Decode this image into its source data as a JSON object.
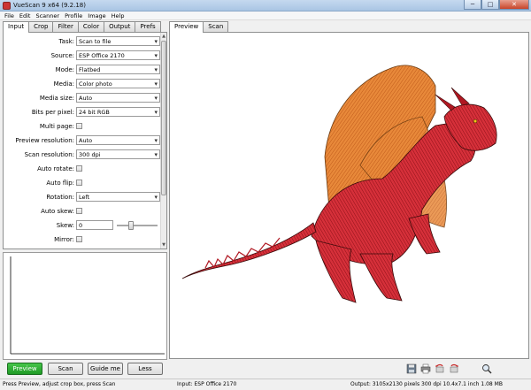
{
  "window": {
    "title": "VueScan 9 x64 (9.2.18)",
    "minimize": "─",
    "maximize": "□",
    "close": "✕"
  },
  "menu": [
    "File",
    "Edit",
    "Scanner",
    "Profile",
    "Image",
    "Help"
  ],
  "left_tabs": [
    "Input",
    "Crop",
    "Filter",
    "Color",
    "Output",
    "Prefs"
  ],
  "right_tabs": [
    "Preview",
    "Scan"
  ],
  "input": {
    "task_label": "Task:",
    "task_value": "Scan to file",
    "source_label": "Source:",
    "source_value": "ESP Office 2170",
    "mode_label": "Mode:",
    "mode_value": "Flatbed",
    "media_label": "Media:",
    "media_value": "Color photo",
    "media_size_label": "Media size:",
    "media_size_value": "Auto",
    "bits_label": "Bits per pixel:",
    "bits_value": "24 bit RGB",
    "multi_page_label": "Multi page:",
    "preview_res_label": "Preview resolution:",
    "preview_res_value": "Auto",
    "scan_res_label": "Scan resolution:",
    "scan_res_value": "300 dpi",
    "auto_rotate_label": "Auto rotate:",
    "auto_flip_label": "Auto flip:",
    "rotation_label": "Rotation:",
    "rotation_value": "Left",
    "auto_skew_label": "Auto skew:",
    "skew_label": "Skew:",
    "skew_value": "0",
    "mirror_label": "Mirror:"
  },
  "buttons": {
    "preview": "Preview",
    "scan": "Scan",
    "guide": "Guide me",
    "less": "Less"
  },
  "status": {
    "hint": "Press Preview, adjust crop box, press Scan",
    "input": "Input: ESP Office 2170",
    "output": "Output: 3105x2130 pixels 300 dpi 10.4x7.1 inch 1.08 MB"
  },
  "colors": {
    "preview_button": "#1f9a25",
    "dragon_red": "#c8202a",
    "wing_orange": "#e07a2e"
  }
}
